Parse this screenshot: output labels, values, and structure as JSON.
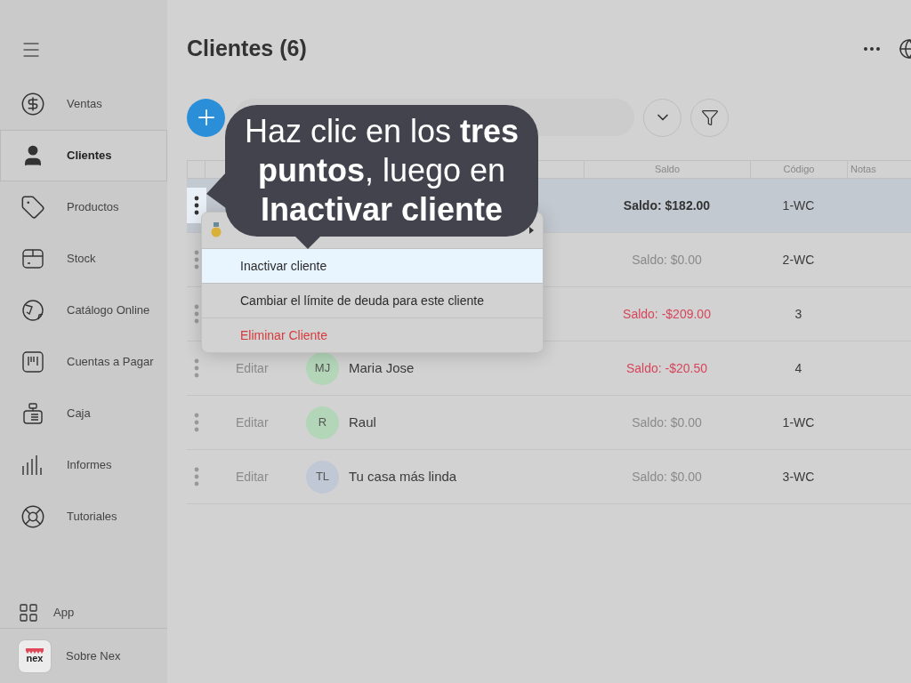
{
  "sidebar": {
    "items": [
      {
        "label": "Ventas",
        "selected": false
      },
      {
        "label": "Clientes",
        "selected": true
      },
      {
        "label": "Productos",
        "selected": false
      },
      {
        "label": "Stock",
        "selected": false
      },
      {
        "label": "Catálogo Online",
        "selected": false
      },
      {
        "label": "Cuentas a Pagar",
        "selected": false
      },
      {
        "label": "Caja",
        "selected": false
      },
      {
        "label": "Informes",
        "selected": false
      },
      {
        "label": "Tutoriales",
        "selected": false
      }
    ],
    "footer": [
      {
        "label": "App"
      },
      {
        "label": "Sobre Nex",
        "logo": "nex"
      }
    ]
  },
  "header": {
    "title": "Clientes (6)"
  },
  "table": {
    "columns": [
      "Saldo",
      "Código",
      "Notas"
    ],
    "rows": [
      {
        "selected": true,
        "balance": "Saldo: $182.00",
        "color": "#333333",
        "code": "1-WC"
      },
      {
        "selected": false,
        "balance": "Saldo: $0.00",
        "color": "#8a8a8a",
        "code": "2-WC"
      },
      {
        "selected": false,
        "balance": "Saldo: -$209.00",
        "color": "#d6455a",
        "code": "3"
      },
      {
        "selected": false,
        "edit": "Editar",
        "avatar": {
          "initials": "MJ",
          "color": "#b3d6b9"
        },
        "name": "Maria Jose",
        "balance": "Saldo: -$20.50",
        "color": "#d6455a",
        "code": "4"
      },
      {
        "selected": false,
        "edit": "Editar",
        "avatar": {
          "initials": "R",
          "color": "#b3d6b9"
        },
        "name": "Raul",
        "balance": "Saldo: $0.00",
        "color": "#8a8a8a",
        "code": "1-WC"
      },
      {
        "selected": false,
        "edit": "Editar",
        "avatar": {
          "initials": "TL",
          "color": "#c0c8d6"
        },
        "name": "Tu casa más linda",
        "balance": "Saldo: $0.00",
        "color": "#8a8a8a",
        "code": "3-WC"
      }
    ]
  },
  "menu": {
    "items": [
      {
        "kind": "submenu",
        "selected": false
      },
      {
        "kind": "normal",
        "label": "Inactivar cliente",
        "selected": true
      },
      {
        "kind": "normal",
        "label": "Cambiar el límite de deuda para este cliente",
        "selected": false
      },
      {
        "kind": "danger",
        "label": "Eliminar Cliente",
        "selected": false
      }
    ]
  },
  "callout": {
    "text": "Haz clic en los **tres puntos**, luego en **Inactivar cliente**"
  }
}
